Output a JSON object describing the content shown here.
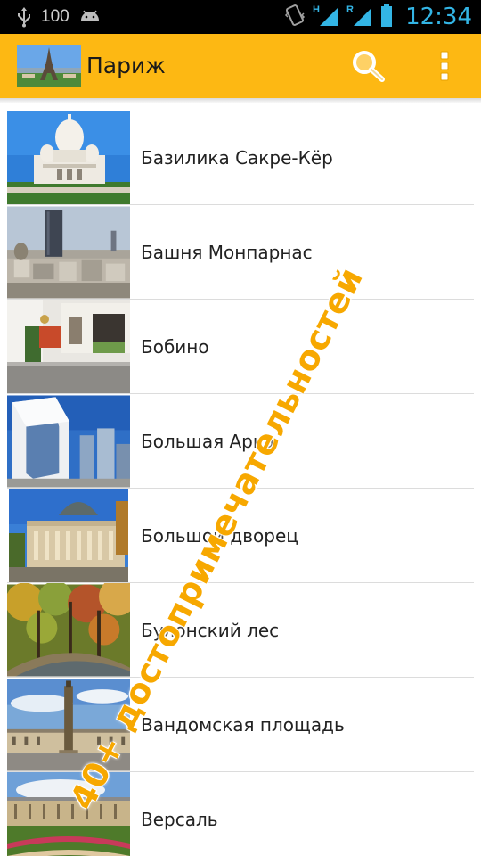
{
  "status_bar": {
    "battery_percent": "100",
    "time": "12:34",
    "icons": [
      "usb-icon",
      "android-icon",
      "vibrate-icon",
      "signal-h-icon",
      "signal-r-icon",
      "battery-icon"
    ]
  },
  "action_bar": {
    "title": "Париж",
    "icons": [
      "app-thumbnail-eiffel",
      "search-icon",
      "overflow-menu-icon"
    ]
  },
  "list": {
    "items": [
      {
        "label": "Базилика Сакре-Кёр"
      },
      {
        "label": "Башня Монпарнас"
      },
      {
        "label": "Бобино"
      },
      {
        "label": "Большая Арка"
      },
      {
        "label": "Большой дворец"
      },
      {
        "label": "Булонский лес"
      },
      {
        "label": "Вандомская площадь"
      },
      {
        "label": "Версаль"
      }
    ]
  },
  "promo_text": "40+ достопримечательностей",
  "colors": {
    "action_bar": "#fdb813",
    "status_bar": "#000000",
    "time": "#33b5e5",
    "promo": "#f7a800"
  }
}
